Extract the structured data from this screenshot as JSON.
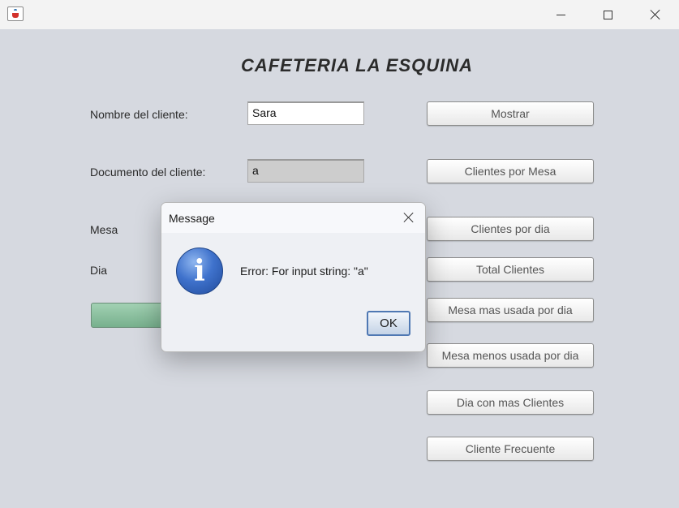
{
  "app": {
    "title": "CAFETERIA LA ESQUINA"
  },
  "form": {
    "nombre_label": "Nombre del cliente:",
    "nombre_value": "Sara",
    "documento_label": "Documento del cliente:",
    "documento_value": "a",
    "mesa_label": "Mesa",
    "dia_label": "Dia"
  },
  "buttons": {
    "mostrar": "Mostrar",
    "clientes_por_mesa": "Clientes por Mesa",
    "clientes_por_dia": "Clientes por dia",
    "total_clientes": "Total Clientes",
    "mesa_mas_usada": "Mesa mas usada por dia",
    "mesa_menos_usada": "Mesa menos usada por dia",
    "dia_con_mas_clientes": "Dia con mas Clientes",
    "cliente_frecuente": "Cliente Frecuente"
  },
  "dialog": {
    "title": "Message",
    "message": "Error: For input string: \"a\"",
    "ok_label": "OK",
    "icon": "info-icon"
  },
  "icons": {
    "app": "java-cup-icon",
    "minimize": "minimize-icon",
    "maximize": "maximize-icon",
    "close": "close-icon"
  },
  "colors": {
    "background": "#d6d9e0",
    "accent_green": "#8cc3a1",
    "info_blue": "#3f72cc"
  }
}
